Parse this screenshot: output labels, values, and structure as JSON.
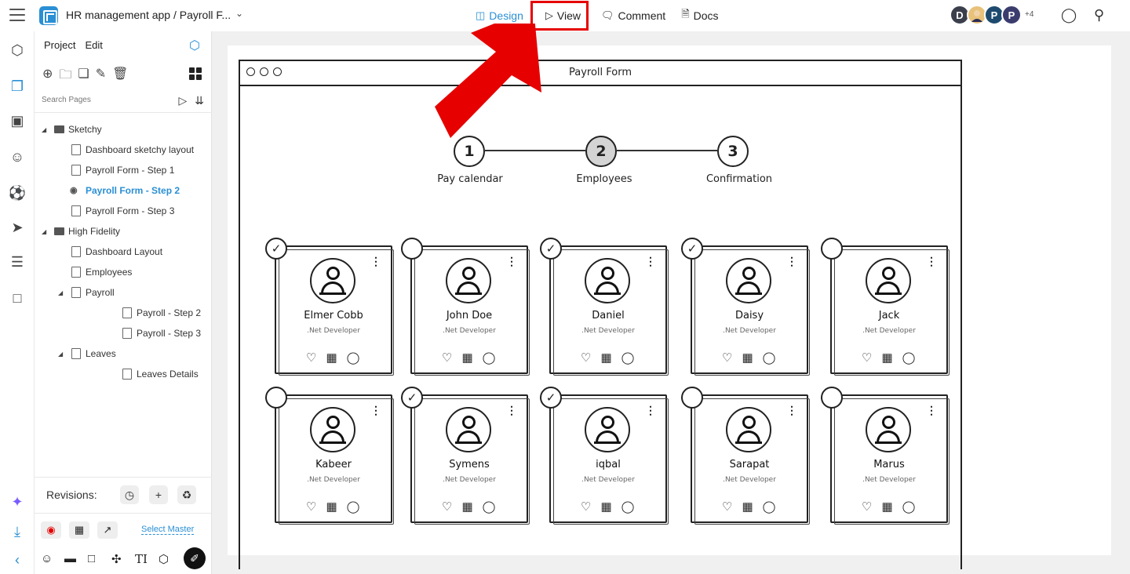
{
  "header": {
    "project_title": "HR management app / Payroll F...",
    "tabs": [
      {
        "label": "Design",
        "icon": "layout-icon"
      },
      {
        "label": "View",
        "icon": "play-icon"
      },
      {
        "label": "Comment",
        "icon": "comment-icon"
      },
      {
        "label": "Docs",
        "icon": "doc-icon"
      }
    ],
    "avatars": [
      {
        "initial": "D",
        "color": "#3a3f4b"
      },
      {
        "initial": "",
        "color": "#e8c27a"
      },
      {
        "initial": "P",
        "color": "#1d4a6e"
      },
      {
        "initial": "P",
        "color": "#3b3c6e"
      }
    ],
    "more_users": "+4"
  },
  "panel": {
    "tabs": [
      "Project",
      "Edit"
    ],
    "search_placeholder": "Search Pages",
    "tree": [
      {
        "label": "Sketchy",
        "type": "folder",
        "level": 0
      },
      {
        "label": "Dashboard sketchy layout",
        "type": "page",
        "level": 1
      },
      {
        "label": "Payroll Form - Step 1",
        "type": "page",
        "level": 1
      },
      {
        "label": "Payroll Form - Step 2",
        "type": "page",
        "level": 1,
        "active": true
      },
      {
        "label": "Payroll Form - Step 3",
        "type": "page",
        "level": 1
      },
      {
        "label": "High Fidelity",
        "type": "folder",
        "level": 0
      },
      {
        "label": "Dashboard Layout",
        "type": "page",
        "level": 1
      },
      {
        "label": "Employees",
        "type": "page",
        "level": 1
      },
      {
        "label": "Payroll",
        "type": "page-parent",
        "level": 1
      },
      {
        "label": "Payroll - Step 2",
        "type": "page",
        "level": 2
      },
      {
        "label": "Payroll - Step 3",
        "type": "page",
        "level": 2
      },
      {
        "label": "Leaves",
        "type": "page-parent",
        "level": 1
      },
      {
        "label": "Leaves Details",
        "type": "page",
        "level": 2
      }
    ],
    "revisions_label": "Revisions:",
    "select_master_label": "Select Master"
  },
  "wireframe": {
    "window_title": "Payroll Form",
    "steps": [
      {
        "number": "1",
        "label": "Pay calendar",
        "current": false
      },
      {
        "number": "2",
        "label": "Employees",
        "current": true
      },
      {
        "number": "3",
        "label": "Confirmation",
        "current": false
      }
    ],
    "employees": [
      {
        "name": "Elmer Cobb",
        "role": ".Net Developer",
        "checked": true
      },
      {
        "name": "John Doe",
        "role": ".Net Developer",
        "checked": false
      },
      {
        "name": "Daniel",
        "role": ".Net Developer",
        "checked": true
      },
      {
        "name": "Daisy",
        "role": ".Net Developer",
        "checked": true
      },
      {
        "name": "Jack",
        "role": ".Net Developer",
        "checked": false
      },
      {
        "name": "Kabeer",
        "role": ".Net Developer",
        "checked": false
      },
      {
        "name": "Symens",
        "role": ".Net Developer",
        "checked": true
      },
      {
        "name": "iqbal",
        "role": ".Net Developer",
        "checked": true
      },
      {
        "name": "Sarapat",
        "role": ".Net Developer",
        "checked": false
      },
      {
        "name": "Marus",
        "role": ".Net Developer",
        "checked": false
      }
    ]
  },
  "colors": {
    "accent": "#2a8fd4",
    "highlight_red": "#e60000"
  }
}
